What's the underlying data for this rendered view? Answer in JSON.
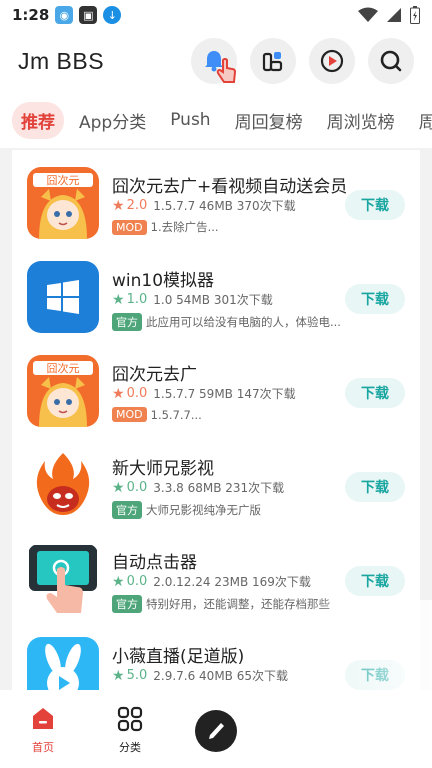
{
  "status_bar": {
    "time": "1:28"
  },
  "header": {
    "title": "Jm BBS"
  },
  "tabs": [
    {
      "label": "推荐",
      "active": true
    },
    {
      "label": "App分类",
      "active": false
    },
    {
      "label": "Push",
      "active": false
    },
    {
      "label": "周回复榜",
      "active": false
    },
    {
      "label": "周浏览榜",
      "active": false
    },
    {
      "label": "周",
      "active": false
    }
  ],
  "apps": [
    {
      "name": "囧次元去广+看视频自动送会员",
      "rating": "2.0",
      "rating_color": "#f07b5a",
      "meta": "1.5.7.7 46MB 370次下载",
      "badge": "MOD",
      "badge_color": "#f0824f",
      "desc": "1.去除广告...",
      "icon": "anime-girl-icon",
      "download": "下载"
    },
    {
      "name": "win10模拟器",
      "rating": "1.0",
      "rating_color": "#5cb38a",
      "meta": "1.0 54MB 301次下载",
      "badge": "官方",
      "badge_color": "#4fa57a",
      "desc": "此应用可以给没有电脑的人，体验电...",
      "icon": "windows-logo-icon",
      "download": "下载"
    },
    {
      "name": "囧次元去广",
      "rating": "0.0",
      "rating_color": "#f07b5a",
      "meta": "1.5.7.7 59MB 147次下载",
      "badge": "MOD",
      "badge_color": "#f0824f",
      "desc": "1.5.7.7...",
      "icon": "anime-girl-icon",
      "download": "下载"
    },
    {
      "name": "新大师兄影视",
      "rating": "0.0",
      "rating_color": "#5cb38a",
      "meta": "3.3.8 68MB 231次下载",
      "badge": "官方",
      "badge_color": "#4fa57a",
      "desc": "大师兄影视纯净无广版",
      "icon": "flame-monkey-icon",
      "download": "下载"
    },
    {
      "name": "自动点击器",
      "rating": "0.0",
      "rating_color": "#5cb38a",
      "meta": "2.0.12.24 23MB 169次下载",
      "badge": "官方",
      "badge_color": "#4fa57a",
      "desc": "特别好用，还能调整，还能存档那些",
      "icon": "tap-hand-icon",
      "download": "下载"
    },
    {
      "name": "小薇直播(足道版)",
      "rating": "5.0",
      "rating_color": "#5cb38a",
      "meta": "2.9.7.6 40MB 65次下载",
      "badge": "",
      "badge_color": "#4fa57a",
      "desc": "",
      "icon": "bunny-play-icon",
      "download": "下载"
    }
  ],
  "bottom_nav": {
    "home_label": "首页",
    "category_label": "分类"
  },
  "colors": {
    "accent": "#e2423a",
    "download_text": "#19a5a0"
  }
}
